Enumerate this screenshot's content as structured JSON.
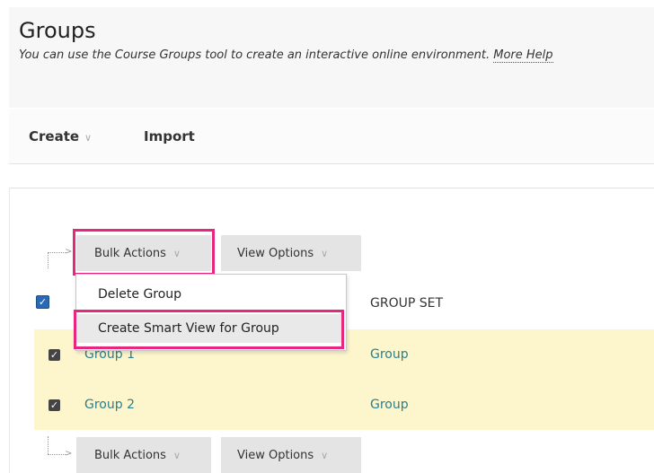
{
  "page": {
    "title": "Groups",
    "description": "You can use the Course Groups tool to create an interactive online environment.",
    "more_help": "More Help"
  },
  "actionbar": {
    "create_label": "Create",
    "import_label": "Import"
  },
  "toolbar": {
    "bulk_actions_label": "Bulk Actions",
    "view_options_label": "View Options"
  },
  "bulk_menu": {
    "items": [
      {
        "label": "Delete Group"
      },
      {
        "label": "Create Smart View for Group"
      }
    ]
  },
  "table": {
    "columns": {
      "group_set": "GROUP SET"
    },
    "rows": [
      {
        "name": "Group 1",
        "group_set": "Group",
        "checked": true
      },
      {
        "name": "Group 2",
        "group_set": "Group",
        "checked": true
      }
    ]
  },
  "colors": {
    "highlight_border": "#e6267f",
    "row_bg": "#fdf5cc",
    "link": "#2c7f8c",
    "button_bg": "#e4e4e4"
  },
  "icons": [
    "chevron-down-icon",
    "checkbox-checked-icon",
    "bracket-arrow-icon"
  ]
}
